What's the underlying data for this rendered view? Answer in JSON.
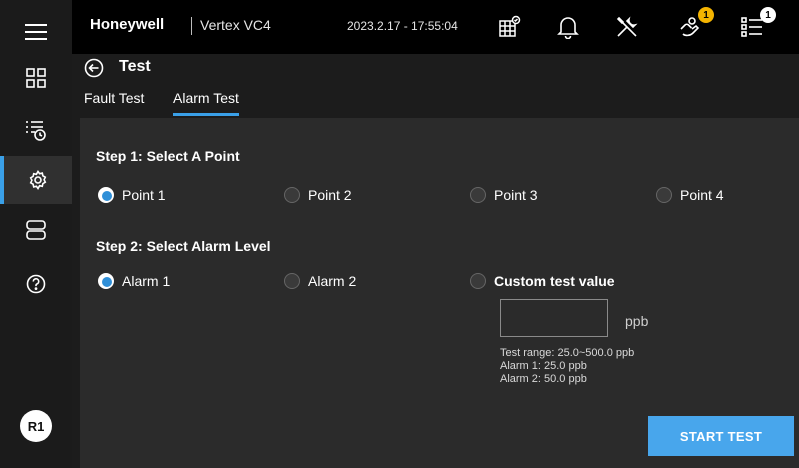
{
  "header": {
    "brand": "Honeywell",
    "product": "Vertex VC4",
    "datetime": "2023.2.17 - 17:55:04",
    "maintenance_badge": "1",
    "events_badge": "1"
  },
  "sidebar": {
    "items": [
      {
        "icon": "menu-icon"
      },
      {
        "icon": "dashboard-icon"
      },
      {
        "icon": "event-list-icon"
      },
      {
        "icon": "settings-icon",
        "active": true
      },
      {
        "icon": "device-icon"
      },
      {
        "icon": "help-icon"
      }
    ],
    "user_initials": "R1"
  },
  "page": {
    "title": "Test",
    "tabs": [
      {
        "label": "Fault Test",
        "active": false
      },
      {
        "label": "Alarm Test",
        "active": true
      }
    ]
  },
  "step1": {
    "title": "Step 1: Select A Point",
    "options": [
      "Point 1",
      "Point 2",
      "Point 3",
      "Point 4"
    ],
    "selected": "Point 1"
  },
  "step2": {
    "title": "Step 2: Select Alarm Level",
    "options": [
      "Alarm 1",
      "Alarm 2",
      "Custom test value"
    ],
    "selected": "Alarm 1",
    "custom_value": "",
    "unit": "ppb",
    "info": [
      "Test range: 25.0~500.0 ppb",
      "Alarm 1: 25.0 ppb",
      "Alarm 2: 50.0 ppb"
    ]
  },
  "actions": {
    "start_test": "START TEST"
  },
  "colors": {
    "accent": "#3aa0e8",
    "button": "#48a6ec",
    "badge": "#f4b400"
  }
}
